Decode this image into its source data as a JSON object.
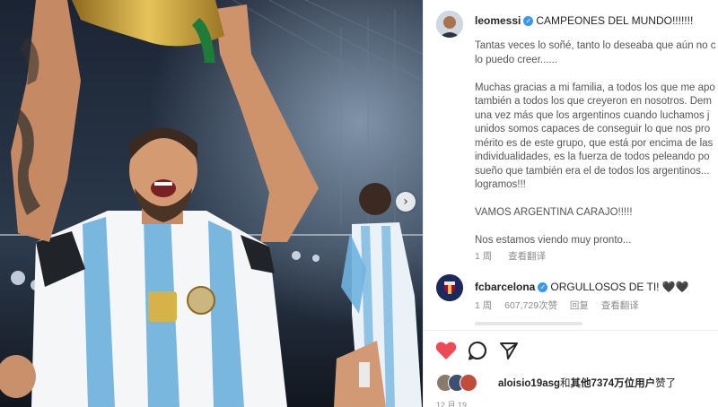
{
  "post": {
    "author": "leomessi",
    "caption_title": "CAMPEONES DEL MUNDO!!!!!!!",
    "caption_lines": [
      "Tantas veces lo soñé, tanto lo deseaba que aún no c",
      "lo puedo creer......",
      "",
      "Muchas gracias a mi familia, a todos los que me apo",
      "también a todos los que creyeron en nosotros. Dem",
      "una vez más que los argentinos cuando luchamos j",
      "unidos somos capaces de conseguir lo que nos pro",
      "mérito es de este grupo, que está por encima de las",
      "individualidades, es la fuerza de todos peleando po",
      "sueño que también era el de todos los argentinos...",
      "logramos!!!",
      "",
      "VAMOS ARGENTINA CARAJO!!!!!",
      "",
      "Nos estamos viendo muy pronto..."
    ],
    "caption_time": "1 周",
    "see_translation": "查看翻译"
  },
  "comments": [
    {
      "author": "fcbarcelona",
      "text": "ORGULLOSOS DE TI! 🖤🖤",
      "time": "1 周",
      "likes": "607,729次赞",
      "reply": "回复",
      "see_translation": "查看翻译"
    }
  ],
  "likes_line": {
    "user": "aloisio19asg",
    "connector": "和",
    "others": "其他7374万位用户",
    "suffix": "赞了"
  },
  "date": "12 月 19",
  "icons": [
    "heart-icon",
    "comment-icon",
    "share-icon",
    "verified-icon",
    "chevron-right-icon"
  ],
  "colors": {
    "like_red": "#ed4956",
    "verified_blue": "#3897f0",
    "meta_gray": "#8e8e8e"
  }
}
